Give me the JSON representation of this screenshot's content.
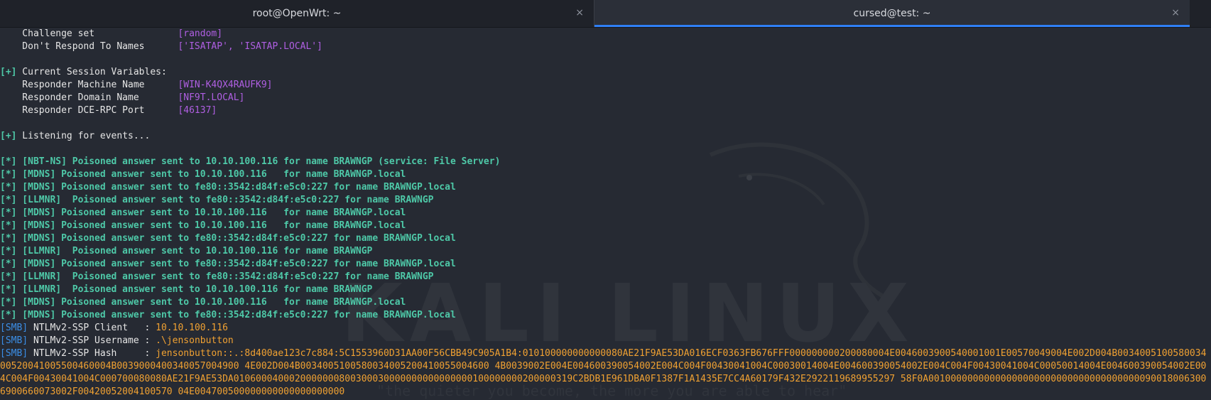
{
  "tabs": [
    {
      "title": "root@OpenWrt: ~",
      "close": "×"
    },
    {
      "title": "cursed@test: ~",
      "close": "×"
    }
  ],
  "config": {
    "challenge_label": "    Challenge set               ",
    "challenge_value": "[random]",
    "dont_respond_label": "    Don't Respond To Names      ",
    "dont_respond_value": "['ISATAP', 'ISATAP.LOCAL']"
  },
  "session": {
    "prefix": "[+]",
    "header": " Current Session Variables:",
    "machine_label": "    Responder Machine Name      ",
    "machine_value": "[WIN-K4QX4RAUFK9]",
    "domain_label": "    Responder Domain Name       ",
    "domain_value": "[NF9T.LOCAL]",
    "port_label": "    Responder DCE-RPC Port      ",
    "port_value": "[46137]"
  },
  "listening": {
    "prefix": "[+]",
    "text": " Listening for events..."
  },
  "events": [
    "[*] [NBT-NS] Poisoned answer sent to 10.10.100.116 for name BRAWNGP (service: File Server)",
    "[*] [MDNS] Poisoned answer sent to 10.10.100.116   for name BRAWNGP.local",
    "[*] [MDNS] Poisoned answer sent to fe80::3542:d84f:e5c0:227 for name BRAWNGP.local",
    "[*] [LLMNR]  Poisoned answer sent to fe80::3542:d84f:e5c0:227 for name BRAWNGP",
    "[*] [MDNS] Poisoned answer sent to 10.10.100.116   for name BRAWNGP.local",
    "[*] [MDNS] Poisoned answer sent to 10.10.100.116   for name BRAWNGP.local",
    "[*] [MDNS] Poisoned answer sent to fe80::3542:d84f:e5c0:227 for name BRAWNGP.local",
    "[*] [LLMNR]  Poisoned answer sent to 10.10.100.116 for name BRAWNGP",
    "[*] [MDNS] Poisoned answer sent to fe80::3542:d84f:e5c0:227 for name BRAWNGP.local",
    "[*] [LLMNR]  Poisoned answer sent to fe80::3542:d84f:e5c0:227 for name BRAWNGP",
    "[*] [LLMNR]  Poisoned answer sent to 10.10.100.116 for name BRAWNGP",
    "[*] [MDNS] Poisoned answer sent to 10.10.100.116   for name BRAWNGP.local",
    "[*] [MDNS] Poisoned answer sent to fe80::3542:d84f:e5c0:227 for name BRAWNGP.local"
  ],
  "smb": {
    "tag": "[SMB]",
    "client_label": " NTLMv2-SSP Client   : ",
    "client_value": "10.10.100.116",
    "username_label": " NTLMv2-SSP Username : ",
    "username_value": ".\\jensonbutton",
    "hash_label": " NTLMv2-SSP Hash     : ",
    "hash_value": "jensonbutton::.:8d400ae123c7c884:5C1553960D31AA00F56CBB49C905A1B4:010100000000000080AE21F9AE53DA016ECF0363FB676FFF000000000200080004E0046003900540001001E00570049004E002D004B003400510058003400520041005500460004B0039000400340057004900 4E002D004B0034005100580034005200410055004600 4B0039002E004E004600390054002E004C004F00430041004C00030014004E004600390054002E004C004F00430041004C00050014004E004600390054002E004C004F00430041004C000700080080AE21F9AE53DA0106000400020000000800300030000000000000000100000000200000319C2BDB1E961DBA0F1387F1A1435E7CC4A60179F432E2922119689955297 58F0A001000000000000000000000000000000000000900180063006900660073002F00420052004100570 04E004700500000000000000000000"
  },
  "watermark": {
    "logo": "KALI LINUX",
    "tagline": "\"the quieter you become, the more you are able to hear\""
  },
  "colors": {
    "background": "#262a33",
    "tabbar": "#1f2229",
    "active_tab_underline": "#2f7ff5",
    "value_purple": "#b05fe3",
    "event_green": "#4ec9a8",
    "smb_blue": "#3b8ee6",
    "hash_orange": "#f0a132"
  }
}
